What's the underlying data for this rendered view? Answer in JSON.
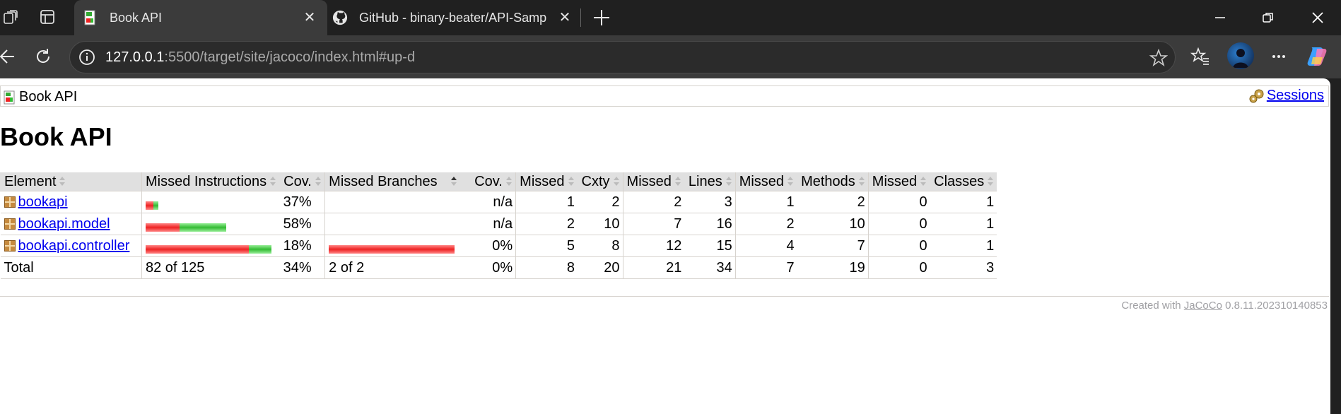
{
  "browser": {
    "tabs": [
      {
        "title": "Book API",
        "active": true
      },
      {
        "title": "GitHub - binary-beater/API-Samp",
        "active": false
      }
    ],
    "url_host": "127.0.0.1",
    "url_rest": ":5500/target/site/jacoco/index.html#up-d"
  },
  "breadcrumb": {
    "report": "Book API",
    "sessions": "Sessions"
  },
  "title": "Book API",
  "table": {
    "headers": [
      "Element",
      "Missed Instructions",
      "Cov.",
      "Missed Branches",
      "Cov.",
      "Missed",
      "Cxty",
      "Missed",
      "Lines",
      "Missed",
      "Methods",
      "Missed",
      "Classes"
    ],
    "rows": [
      {
        "name": "bookapi",
        "instr_missed_frac": 0.63,
        "instr_bar_scale": 0.1,
        "instr_cov": "37%",
        "branch_missed_frac": null,
        "branch_cov": "n/a",
        "cxty_missed": "1",
        "cxty": "2",
        "lines_missed": "2",
        "lines": "3",
        "methods_missed": "1",
        "methods": "2",
        "classes_missed": "0",
        "classes": "1"
      },
      {
        "name": "bookapi.model",
        "instr_missed_frac": 0.42,
        "instr_bar_scale": 0.64,
        "instr_cov": "58%",
        "branch_missed_frac": null,
        "branch_cov": "n/a",
        "cxty_missed": "2",
        "cxty": "10",
        "lines_missed": "7",
        "lines": "16",
        "methods_missed": "2",
        "methods": "10",
        "classes_missed": "0",
        "classes": "1"
      },
      {
        "name": "bookapi.controller",
        "instr_missed_frac": 0.82,
        "instr_bar_scale": 1.0,
        "instr_cov": "18%",
        "branch_missed_frac": 1.0,
        "branch_cov": "0%",
        "cxty_missed": "5",
        "cxty": "8",
        "lines_missed": "12",
        "lines": "15",
        "methods_missed": "4",
        "methods": "7",
        "classes_missed": "0",
        "classes": "1"
      }
    ],
    "total": {
      "label": "Total",
      "instr": "82 of 125",
      "instr_cov": "34%",
      "branch": "2 of 2",
      "branch_cov": "0%",
      "cxty_missed": "8",
      "cxty": "20",
      "lines_missed": "21",
      "lines": "34",
      "methods_missed": "7",
      "methods": "19",
      "classes_missed": "0",
      "classes": "3"
    }
  },
  "footer": {
    "prefix": "Created with ",
    "link": "JaCoCo",
    "version": " 0.8.11.202310140853"
  },
  "colors": {
    "bar_red": "#e22222",
    "bar_green": "#33bb33",
    "link": "#0000ee"
  }
}
